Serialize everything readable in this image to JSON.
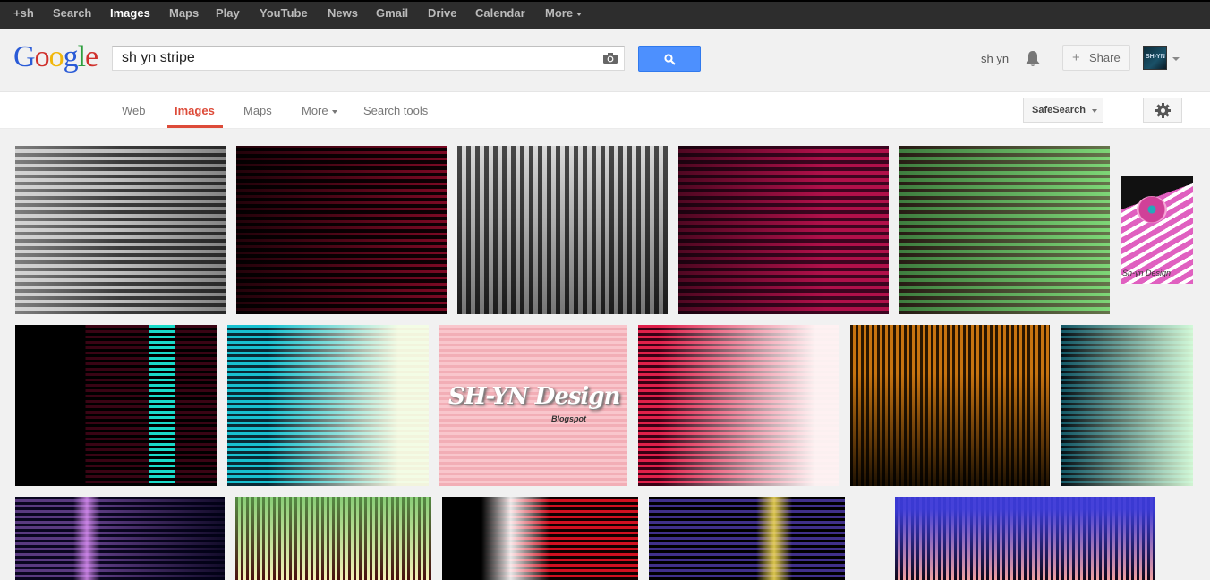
{
  "topbar": {
    "items": [
      {
        "label": "+sh",
        "active": false
      },
      {
        "label": "Search",
        "active": false
      },
      {
        "label": "Images",
        "active": true
      },
      {
        "label": "Maps",
        "active": false
      },
      {
        "label": "Play",
        "active": false
      },
      {
        "label": "YouTube",
        "active": false
      },
      {
        "label": "News",
        "active": false
      },
      {
        "label": "Gmail",
        "active": false
      },
      {
        "label": "Drive",
        "active": false
      },
      {
        "label": "Calendar",
        "active": false
      },
      {
        "label": "More",
        "active": false
      }
    ]
  },
  "header": {
    "logo_letters": [
      "G",
      "o",
      "o",
      "g",
      "l",
      "e"
    ],
    "logo_colors": [
      "#2a5bd7",
      "#d0312d",
      "#f1b70c",
      "#2a5bd7",
      "#2e9e3e",
      "#d0312d"
    ],
    "search_value": "sh yn stripe",
    "user_name": "sh yn",
    "share_label": "Share",
    "avatar_text": "SH-YN"
  },
  "nav": {
    "tabs": [
      {
        "label": "Web",
        "active": false
      },
      {
        "label": "Images",
        "active": true
      },
      {
        "label": "Maps",
        "active": false
      },
      {
        "label": "More",
        "active": false
      },
      {
        "label": "Search tools",
        "active": false
      }
    ],
    "safesearch_label": "SafeSearch",
    "accent_color": "#dd4b39"
  },
  "results": {
    "tile_watermark_small": "Sh-yn Design",
    "tile_logo_text": "SH-YN Design",
    "tile_logo_sub": "Blogspot"
  }
}
